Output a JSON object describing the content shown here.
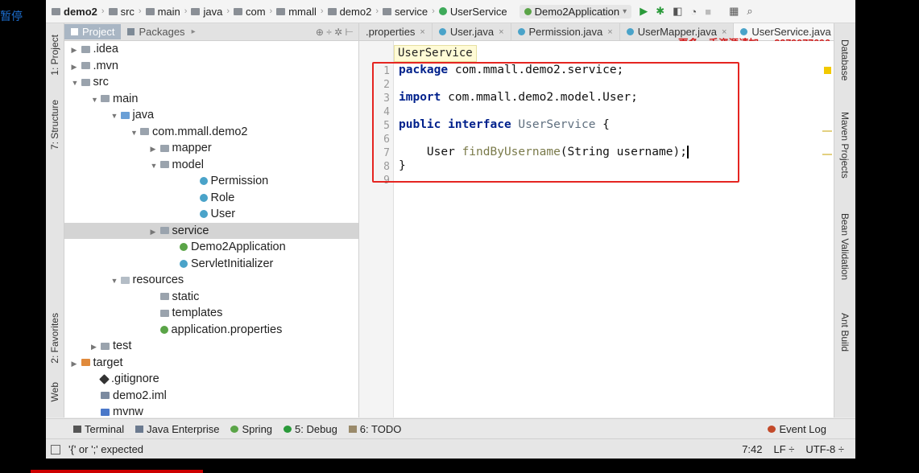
{
  "corner_text": "暂停",
  "nav": {
    "crumbs": [
      "demo2",
      "src",
      "main",
      "java",
      "com",
      "mmall",
      "demo2",
      "service",
      "UserService"
    ],
    "run_config": "Demo2Application"
  },
  "left_strip": {
    "project": "1: Project",
    "structure": "7: Structure",
    "favorites": "2: Favorites",
    "web": "Web"
  },
  "right_strip": {
    "database": "Database",
    "maven": "Maven Projects",
    "bean": "Bean Validation",
    "ant": "Ant Build"
  },
  "project_panel": {
    "tabs": [
      "Project",
      "Packages"
    ],
    "tree": [
      {
        "label": ".idea",
        "depth": 1,
        "toggle": "▶",
        "icon": "fold"
      },
      {
        "label": ".mvn",
        "depth": 1,
        "toggle": "▶",
        "icon": "fold"
      },
      {
        "label": "src",
        "depth": 1,
        "toggle": "▼",
        "icon": "fold"
      },
      {
        "label": "main",
        "depth": 2,
        "toggle": "▼",
        "icon": "fold"
      },
      {
        "label": "java",
        "depth": 3,
        "toggle": "▼",
        "icon": "srcf"
      },
      {
        "label": "com.mmall.demo2",
        "depth": 4,
        "toggle": "▼",
        "icon": "fold"
      },
      {
        "label": "mapper",
        "depth": 5,
        "toggle": "▶",
        "icon": "fold"
      },
      {
        "label": "model",
        "depth": 5,
        "toggle": "▼",
        "icon": "fold"
      },
      {
        "label": "Permission",
        "depth": 7,
        "toggle": "",
        "icon": "cls"
      },
      {
        "label": "Role",
        "depth": 7,
        "toggle": "",
        "icon": "cls"
      },
      {
        "label": "User",
        "depth": 7,
        "toggle": "",
        "icon": "cls"
      },
      {
        "label": "service",
        "depth": 5,
        "toggle": "▶",
        "icon": "fold",
        "selected": true
      },
      {
        "label": "Demo2Application",
        "depth": 6,
        "toggle": "",
        "icon": "spr"
      },
      {
        "label": "ServletInitializer",
        "depth": 6,
        "toggle": "",
        "icon": "cls"
      },
      {
        "label": "resources",
        "depth": 3,
        "toggle": "▼",
        "icon": "resf"
      },
      {
        "label": "static",
        "depth": 5,
        "toggle": "",
        "icon": "fold"
      },
      {
        "label": "templates",
        "depth": 5,
        "toggle": "",
        "icon": "fold"
      },
      {
        "label": "application.properties",
        "depth": 5,
        "toggle": "",
        "icon": "spr"
      },
      {
        "label": "test",
        "depth": 2,
        "toggle": "▶",
        "icon": "fold"
      },
      {
        "label": "target",
        "depth": 1,
        "toggle": "▶",
        "icon": "tgtf"
      },
      {
        "label": ".gitignore",
        "depth": 2,
        "toggle": "",
        "icon": "git"
      },
      {
        "label": "demo2.iml",
        "depth": 2,
        "toggle": "",
        "icon": "iml"
      },
      {
        "label": "mvnw",
        "depth": 2,
        "toggle": "",
        "icon": "mvn"
      }
    ]
  },
  "editor": {
    "tabs": [
      ".properties",
      "User.java",
      "Permission.java",
      "UserMapper.java",
      "UserService.java"
    ],
    "breadcrumb": "UserService",
    "watermark": "更多一手资源请加qq:3379977696",
    "lines": [
      "1",
      "2",
      "3",
      "4",
      "5",
      "6",
      "7",
      "8",
      "9"
    ]
  },
  "toolbar": {
    "terminal": "Terminal",
    "java_enterprise": "Java Enterprise",
    "spring": "Spring",
    "debug": "5: Debug",
    "todo": "6: TODO",
    "event_log": "Event Log"
  },
  "status": {
    "message": "'{' or ';' expected",
    "position": "7:42",
    "line_sep": "LF ÷",
    "encoding": "UTF-8 ÷"
  }
}
